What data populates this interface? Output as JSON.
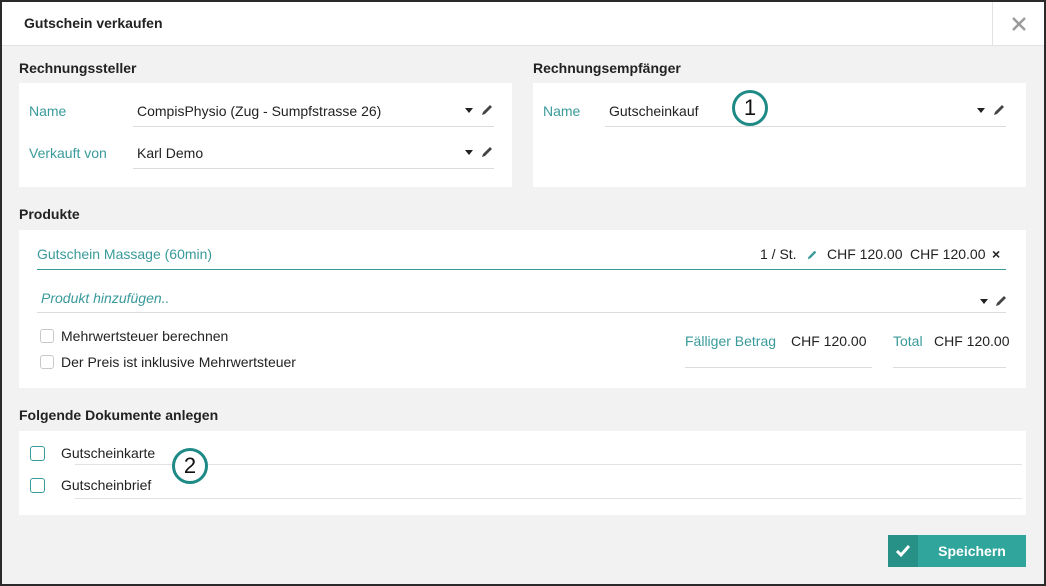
{
  "dialog": {
    "title": "Gutschein verkaufen",
    "close_glyph": "✕"
  },
  "issuer": {
    "section_title": "Rechnungssteller",
    "name_label": "Name",
    "name_value": "CompisPhysio (Zug - Sumpfstrasse 26)",
    "sold_by_label": "Verkauft von",
    "sold_by_value": "Karl Demo"
  },
  "recipient": {
    "section_title": "Rechnungsempfänger",
    "name_label": "Name",
    "name_value": "Gutscheinkauf"
  },
  "markers": {
    "one": "1",
    "two": "2"
  },
  "products": {
    "section_title": "Produkte",
    "items": [
      {
        "name": "Gutschein Massage (60min)",
        "quantity": "1 / St.",
        "unit_price": "CHF 120.00",
        "total": "CHF 120.00",
        "remove_glyph": "×"
      }
    ],
    "add_placeholder": "Produkt hinzufügen..",
    "vat_calc_label": "Mehrwertsteuer berechnen",
    "vat_inclusive_label": "Der Preis ist inklusive Mehrwertsteuer",
    "due_label": "Fälliger Betrag",
    "due_value": "CHF 120.00",
    "total_label": "Total",
    "total_value": "CHF 120.00"
  },
  "documents": {
    "section_title": "Folgende Dokumente anlegen",
    "items": [
      {
        "label": "Gutscheinkarte",
        "checked": false
      },
      {
        "label": "Gutscheinbrief",
        "checked": false
      }
    ]
  },
  "footer": {
    "save_label": "Speichern"
  },
  "colors": {
    "accent": "#3a9a9a",
    "button": "#2fa59c",
    "marker_border": "#1e8a86"
  }
}
